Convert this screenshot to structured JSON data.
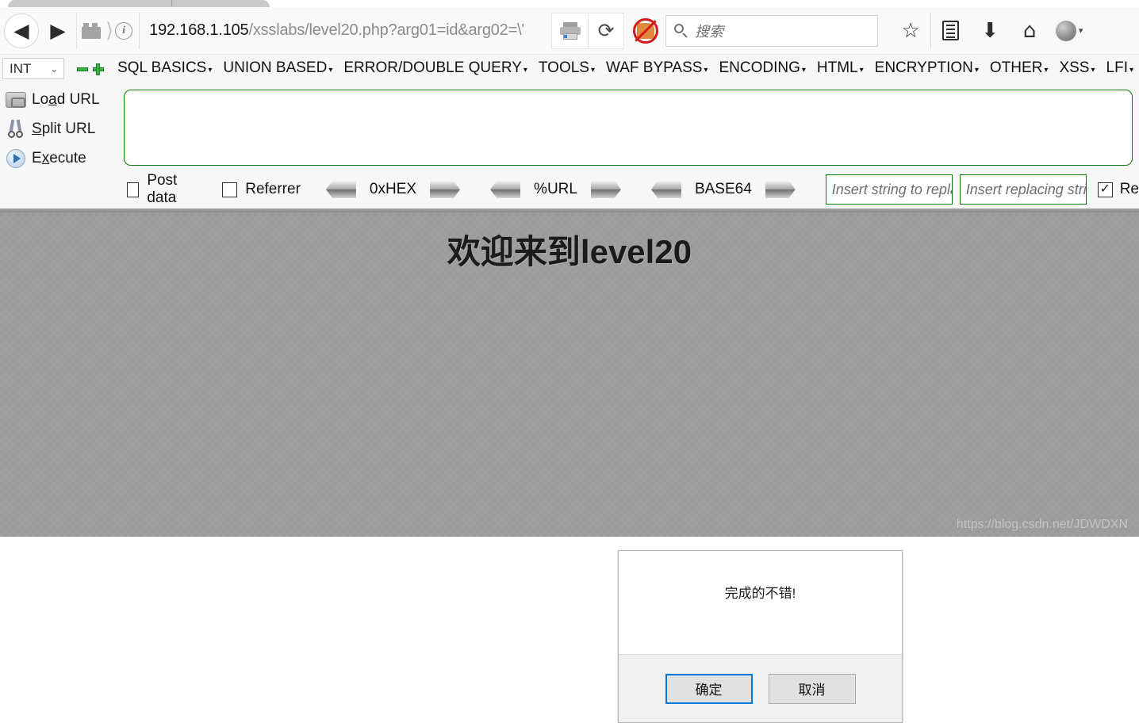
{
  "browser": {
    "nav": {
      "back_label": "◀",
      "forward_label": "▶",
      "site_icon": "site-identity-icon",
      "info_icon": "info-circle-icon",
      "reload_label": "⟳",
      "print_icon": "printer-icon"
    },
    "url": {
      "host": "192.168.1.105",
      "path": "/xsslabs/level20.php?arg01=id&arg02=\\'",
      "full": "192.168.1.105/xsslabs/level20.php?arg01=id&arg02=\\'"
    },
    "search": {
      "placeholder": "搜索"
    },
    "toolbar_icons": [
      {
        "name": "noscript-icon",
        "glyph": ""
      },
      {
        "name": "bookmark-star-icon",
        "glyph": "☆"
      },
      {
        "name": "reader-list-icon",
        "glyph": ""
      },
      {
        "name": "downloads-icon",
        "glyph": "⬇"
      },
      {
        "name": "home-icon",
        "glyph": "⌂"
      },
      {
        "name": "account-avatar-icon",
        "glyph": ""
      },
      {
        "name": "menu-caret-icon",
        "glyph": "▾"
      }
    ]
  },
  "hackbar": {
    "type_select": {
      "value": "INT",
      "caret": "⌄"
    },
    "remove_button": "minus",
    "add_button": "plus",
    "menu": [
      {
        "label": "SQL BASICS",
        "caret": "▾"
      },
      {
        "label": "UNION BASED",
        "caret": "▾"
      },
      {
        "label": "ERROR/DOUBLE QUERY",
        "caret": "▾"
      },
      {
        "label": "TOOLS",
        "caret": "▾"
      },
      {
        "label": "WAF BYPASS",
        "caret": "▾"
      },
      {
        "label": "ENCODING",
        "caret": "▾"
      },
      {
        "label": "HTML",
        "caret": "▾"
      },
      {
        "label": "ENCRYPTION",
        "caret": "▾"
      },
      {
        "label": "OTHER",
        "caret": "▾"
      },
      {
        "label": "XSS",
        "caret": "▾"
      },
      {
        "label": "LFI",
        "caret": "▾"
      }
    ],
    "actions": [
      {
        "name": "load-url",
        "label_pre": "Lo",
        "label_accel": "a",
        "label_post": "d URL"
      },
      {
        "name": "split-url",
        "label_pre": "",
        "label_accel": "S",
        "label_post": "plit URL"
      },
      {
        "name": "execute",
        "label_pre": "E",
        "label_accel": "x",
        "label_post": "ecute"
      }
    ],
    "textarea_value": "",
    "checkboxes": [
      {
        "label": "Post data",
        "checked": false
      },
      {
        "label": "Referrer",
        "checked": false
      }
    ],
    "converters": [
      {
        "label": "0xHEX"
      },
      {
        "label": "%URL"
      },
      {
        "label": "BASE64"
      }
    ],
    "replace_fields": [
      {
        "placeholder": "Insert string to replace",
        "value": ""
      },
      {
        "placeholder": "Insert replacing string",
        "value": ""
      }
    ],
    "tail_checkbox": {
      "label": "Re",
      "checked": true
    }
  },
  "page": {
    "title": "欢迎来到level20",
    "dialog": {
      "message": "完成的不错!",
      "confirm_label": "确定",
      "cancel_label": "取消"
    },
    "watermark": "https://blog.csdn.net/JDWDXN"
  },
  "colors": {
    "accent_blue": "#0078d7",
    "hackbar_green": "#0a7b0a",
    "page_bg": "#9b9b9b"
  }
}
